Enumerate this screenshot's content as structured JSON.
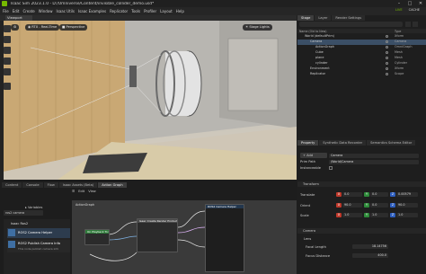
{
  "window": {
    "title": "Isaac Sim 2023.1.0 - D:/Omniverse/Content/invisible_collider_demo.usd*",
    "controls": [
      "–",
      "□",
      "✕"
    ]
  },
  "menu": {
    "items": [
      "File",
      "Edit",
      "Create",
      "Window",
      "Isaac Utils",
      "Isaac Examples",
      "Replicator",
      "Tools",
      "Profiler",
      "Layout",
      "Help"
    ],
    "right": [
      "LIVE",
      "CACHE"
    ]
  },
  "viewport": {
    "tab": "Viewport",
    "render_mode": "RTX - Real-Time",
    "camera": "Perspective",
    "lights": "Stage Lights"
  },
  "stage": {
    "tabs": [
      "Stage",
      "Layer",
      "Render Settings"
    ],
    "col_name": "Name (Old to New)",
    "col_type": "Type",
    "rows": [
      {
        "name": "World (defaultPrim)",
        "type": "Xform",
        "indent": 0,
        "selected": false
      },
      {
        "name": "Camera",
        "type": "Camera",
        "indent": 1,
        "selected": true
      },
      {
        "name": "ActionGraph",
        "type": "OmniGraph",
        "indent": 2,
        "selected": false
      },
      {
        "name": "Cube",
        "type": "Mesh",
        "indent": 2,
        "selected": false
      },
      {
        "name": "plane",
        "type": "Mesh",
        "indent": 2,
        "selected": false
      },
      {
        "name": "cylinder",
        "type": "Cylinder",
        "indent": 2,
        "selected": false
      },
      {
        "name": "Environment",
        "type": "Xform",
        "indent": 1,
        "selected": false
      },
      {
        "name": "Replicator",
        "type": "Scope",
        "indent": 1,
        "selected": false
      }
    ]
  },
  "property": {
    "tabs": [
      "Property",
      "Synthetic Data Recorder",
      "Semantics Schema Editor"
    ],
    "add_label": "Add",
    "type_value": "Camera",
    "prim_path_label": "Prim Path",
    "prim_path": "/World/Camera",
    "instanceable_label": "Instanceable",
    "transform_label": "Transform",
    "translate_label": "Translate",
    "translate": [
      "0.0",
      "0.0",
      "0.00579"
    ],
    "orient_label": "Orient",
    "orient": [
      "90.0",
      "0.0",
      "90.0"
    ],
    "scale_label": "Scale",
    "scale": [
      "1.0",
      "1.0",
      "1.0"
    ],
    "camera_label": "Camera",
    "lens_label": "Lens",
    "focal_length_label": "Focal Length",
    "focal_length": "18.14756",
    "focus_distance_label": "Focus Distance",
    "focus_distance": "400.0"
  },
  "bottom": {
    "tabs": [
      "Content",
      "Console",
      "Flow",
      "Isaac Assets (Beta)",
      "Action Graph"
    ],
    "active_tab": "Action Graph",
    "toolbar": [
      "Edit",
      "View"
    ],
    "search_value": "ros2 camera",
    "variables_label": "Variables",
    "list_header": "Isaac Ros2",
    "list_items": [
      {
        "title": "ROS2 Camera Helper",
        "sub": ""
      },
      {
        "title": "ROS2 Publish Camera Info",
        "sub": "This node publish camera info"
      }
    ],
    "graph_title": "ActionGraph",
    "nodes": {
      "tick": "On Playback Tick",
      "render": "Isaac Create Render Product",
      "camera_helper": "ROS2 Camera Helper"
    }
  },
  "colors": {
    "accent": "#76b900",
    "selection": "#3b4f66",
    "x_axis": "#c0392b",
    "y_axis": "#2e8b3a",
    "z_axis": "#2f5fbf"
  }
}
